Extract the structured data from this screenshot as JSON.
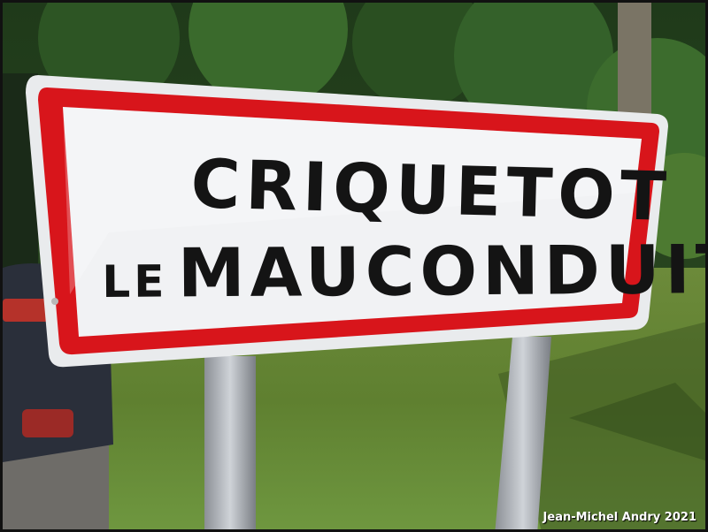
{
  "sign": {
    "line1": "CRIQUETOT",
    "line2_prefix": "LE",
    "line2_main": "MAUCONDUIT",
    "border_color": "#d8151b",
    "face_color": "#f1f2f4"
  },
  "credit": "Jean-Michel Andry 2021"
}
